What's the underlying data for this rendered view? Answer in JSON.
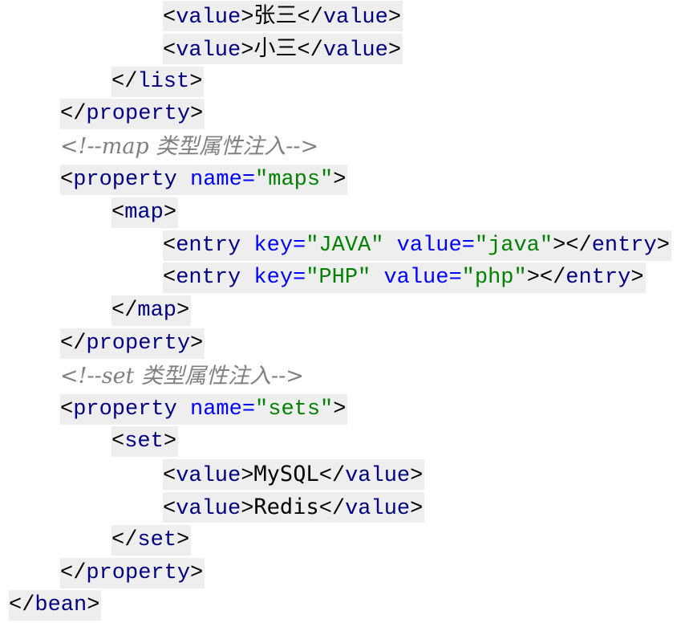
{
  "document": {
    "lines": [
      {
        "indent": 3,
        "comment": false,
        "tokens": [
          {
            "t": "<",
            "c": "punct"
          },
          {
            "t": "value",
            "c": "tag"
          },
          {
            "t": ">",
            "c": "punct"
          },
          {
            "t": "张三",
            "c": "txt"
          },
          {
            "t": "</",
            "c": "punct"
          },
          {
            "t": "value",
            "c": "tag"
          },
          {
            "t": ">",
            "c": "punct"
          }
        ]
      },
      {
        "indent": 3,
        "comment": false,
        "tokens": [
          {
            "t": "<",
            "c": "punct"
          },
          {
            "t": "value",
            "c": "tag"
          },
          {
            "t": ">",
            "c": "punct"
          },
          {
            "t": "小三",
            "c": "txt"
          },
          {
            "t": "</",
            "c": "punct"
          },
          {
            "t": "value",
            "c": "tag"
          },
          {
            "t": ">",
            "c": "punct"
          }
        ]
      },
      {
        "indent": 2,
        "comment": false,
        "tokens": [
          {
            "t": "</",
            "c": "punct"
          },
          {
            "t": "list",
            "c": "tag"
          },
          {
            "t": ">",
            "c": "punct"
          }
        ]
      },
      {
        "indent": 1,
        "comment": false,
        "tokens": [
          {
            "t": "</",
            "c": "punct"
          },
          {
            "t": "property",
            "c": "tag"
          },
          {
            "t": ">",
            "c": "punct"
          }
        ]
      },
      {
        "indent": 1,
        "comment": true,
        "tokens": [
          {
            "t": "<!--map 类型属性注入-->",
            "c": "cmt"
          }
        ]
      },
      {
        "indent": 1,
        "comment": false,
        "tokens": [
          {
            "t": "<",
            "c": "punct"
          },
          {
            "t": "property",
            "c": "tag"
          },
          {
            "t": " ",
            "c": "punct"
          },
          {
            "t": "name=",
            "c": "attr"
          },
          {
            "t": "\"maps\"",
            "c": "str"
          },
          {
            "t": ">",
            "c": "punct"
          }
        ]
      },
      {
        "indent": 2,
        "comment": false,
        "tokens": [
          {
            "t": "<",
            "c": "punct"
          },
          {
            "t": "map",
            "c": "tag"
          },
          {
            "t": ">",
            "c": "punct"
          }
        ]
      },
      {
        "indent": 3,
        "comment": false,
        "tokens": [
          {
            "t": "<",
            "c": "punct"
          },
          {
            "t": "entry",
            "c": "tag"
          },
          {
            "t": " ",
            "c": "punct"
          },
          {
            "t": "key=",
            "c": "attr"
          },
          {
            "t": "\"JAVA\"",
            "c": "str"
          },
          {
            "t": " ",
            "c": "punct"
          },
          {
            "t": "value=",
            "c": "attr"
          },
          {
            "t": "\"java\"",
            "c": "str"
          },
          {
            "t": "></",
            "c": "punct"
          },
          {
            "t": "entry",
            "c": "tag"
          },
          {
            "t": ">",
            "c": "punct"
          }
        ]
      },
      {
        "indent": 3,
        "comment": false,
        "tokens": [
          {
            "t": "<",
            "c": "punct"
          },
          {
            "t": "entry",
            "c": "tag"
          },
          {
            "t": " ",
            "c": "punct"
          },
          {
            "t": "key=",
            "c": "attr"
          },
          {
            "t": "\"PHP\"",
            "c": "str"
          },
          {
            "t": " ",
            "c": "punct"
          },
          {
            "t": "value=",
            "c": "attr"
          },
          {
            "t": "\"php\"",
            "c": "str"
          },
          {
            "t": "></",
            "c": "punct"
          },
          {
            "t": "entry",
            "c": "tag"
          },
          {
            "t": ">",
            "c": "punct"
          }
        ]
      },
      {
        "indent": 2,
        "comment": false,
        "tokens": [
          {
            "t": "</",
            "c": "punct"
          },
          {
            "t": "map",
            "c": "tag"
          },
          {
            "t": ">",
            "c": "punct"
          }
        ]
      },
      {
        "indent": 1,
        "comment": false,
        "tokens": [
          {
            "t": "</",
            "c": "punct"
          },
          {
            "t": "property",
            "c": "tag"
          },
          {
            "t": ">",
            "c": "punct"
          }
        ]
      },
      {
        "indent": 1,
        "comment": true,
        "tokens": [
          {
            "t": "<!--set 类型属性注入-->",
            "c": "cmt"
          }
        ]
      },
      {
        "indent": 1,
        "comment": false,
        "tokens": [
          {
            "t": "<",
            "c": "punct"
          },
          {
            "t": "property",
            "c": "tag"
          },
          {
            "t": " ",
            "c": "punct"
          },
          {
            "t": "name=",
            "c": "attr"
          },
          {
            "t": "\"sets\"",
            "c": "str"
          },
          {
            "t": ">",
            "c": "punct"
          }
        ]
      },
      {
        "indent": 2,
        "comment": false,
        "tokens": [
          {
            "t": "<",
            "c": "punct"
          },
          {
            "t": "set",
            "c": "tag"
          },
          {
            "t": ">",
            "c": "punct"
          }
        ]
      },
      {
        "indent": 3,
        "comment": false,
        "tokens": [
          {
            "t": "<",
            "c": "punct"
          },
          {
            "t": "value",
            "c": "tag"
          },
          {
            "t": ">",
            "c": "punct"
          },
          {
            "t": "MySQL",
            "c": "txt"
          },
          {
            "t": "</",
            "c": "punct"
          },
          {
            "t": "value",
            "c": "tag"
          },
          {
            "t": ">",
            "c": "punct"
          }
        ]
      },
      {
        "indent": 3,
        "comment": false,
        "tokens": [
          {
            "t": "<",
            "c": "punct"
          },
          {
            "t": "value",
            "c": "tag"
          },
          {
            "t": ">",
            "c": "punct"
          },
          {
            "t": "Redis",
            "c": "txt"
          },
          {
            "t": "</",
            "c": "punct"
          },
          {
            "t": "value",
            "c": "tag"
          },
          {
            "t": ">",
            "c": "punct"
          }
        ]
      },
      {
        "indent": 2,
        "comment": false,
        "tokens": [
          {
            "t": "</",
            "c": "punct"
          },
          {
            "t": "set",
            "c": "tag"
          },
          {
            "t": ">",
            "c": "punct"
          }
        ]
      },
      {
        "indent": 1,
        "comment": false,
        "tokens": [
          {
            "t": "</",
            "c": "punct"
          },
          {
            "t": "property",
            "c": "tag"
          },
          {
            "t": ">",
            "c": "punct"
          }
        ]
      },
      {
        "indent": 0,
        "comment": false,
        "tokens": [
          {
            "t": "</",
            "c": "punct"
          },
          {
            "t": "bean",
            "c": "tag"
          },
          {
            "t": ">",
            "c": "punct"
          }
        ]
      }
    ]
  },
  "colors": {
    "tag": "#000080",
    "attribute": "#0000ff",
    "string": "#008000",
    "comment": "#808080",
    "text": "#000000",
    "line_background": "#eeeeee"
  }
}
